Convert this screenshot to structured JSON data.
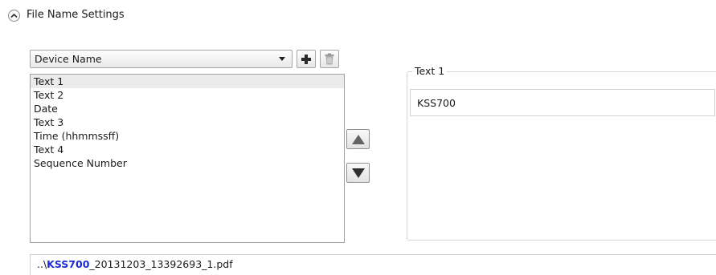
{
  "section": {
    "title": "File Name Settings",
    "toggle_icon": "chevron-up-icon"
  },
  "dropdown": {
    "selected": "Device Name"
  },
  "toolbar": {
    "add_icon": "plus-icon",
    "delete_icon": "trash-icon"
  },
  "list": {
    "items": [
      {
        "label": "Text 1",
        "selected": true
      },
      {
        "label": "Text 2",
        "selected": false
      },
      {
        "label": "Date",
        "selected": false
      },
      {
        "label": "Text 3",
        "selected": false
      },
      {
        "label": "Time (hhmmssff)",
        "selected": false
      },
      {
        "label": "Text 4",
        "selected": false
      },
      {
        "label": "Sequence Number",
        "selected": false
      }
    ]
  },
  "move": {
    "up_icon": "arrow-up-icon",
    "down_icon": "arrow-down-icon"
  },
  "group": {
    "legend": "Text 1",
    "value": "KSS700"
  },
  "preview": {
    "prefix": "..\\",
    "highlight": "KSS700",
    "suffix": "_20131203_13392693_1.pdf"
  },
  "colors": {
    "highlight": "#1a2cd6",
    "selected_row": "#ebebeb"
  }
}
